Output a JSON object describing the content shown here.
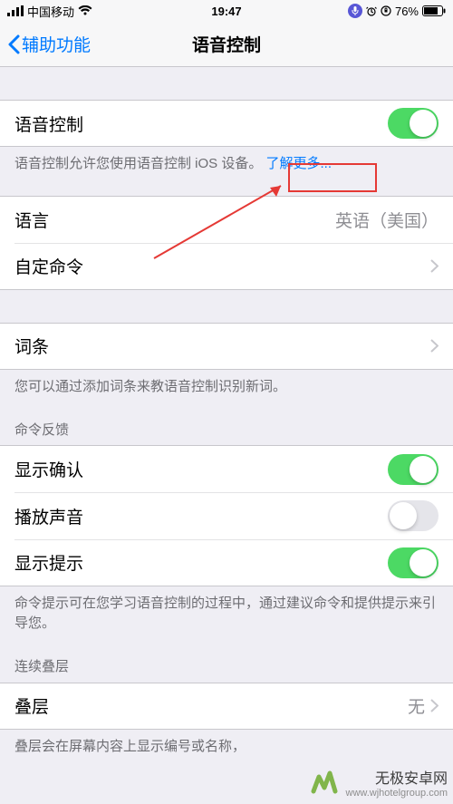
{
  "status": {
    "carrier": "中国移动",
    "time": "19:47",
    "battery": "76%"
  },
  "nav": {
    "back": "辅助功能",
    "title": "语音控制"
  },
  "voice": {
    "label": "语音控制",
    "on": true
  },
  "desc": {
    "text": "语音控制允许您使用语音控制 iOS 设备。",
    "link": "了解更多..."
  },
  "lang": {
    "label": "语言",
    "value": "英语（美国）"
  },
  "custom": {
    "label": "自定命令"
  },
  "vocab": {
    "label": "词条",
    "footer": "您可以通过添加词条来教语音控制识别新词。"
  },
  "feedback": {
    "header": "命令反馈",
    "confirm": {
      "label": "显示确认",
      "on": true
    },
    "sound": {
      "label": "播放声音",
      "on": false
    },
    "hint": {
      "label": "显示提示",
      "on": true
    },
    "footer": "命令提示可在您学习语音控制的过程中，通过建议命令和提供提示来引导您。"
  },
  "overlay": {
    "header": "连续叠层",
    "label": "叠层",
    "value": "无",
    "footer": "叠层会在屏幕内容上显示编号或名称，"
  },
  "watermark": {
    "title": "无极安卓网",
    "url": "www.wjhotelgroup.com"
  }
}
